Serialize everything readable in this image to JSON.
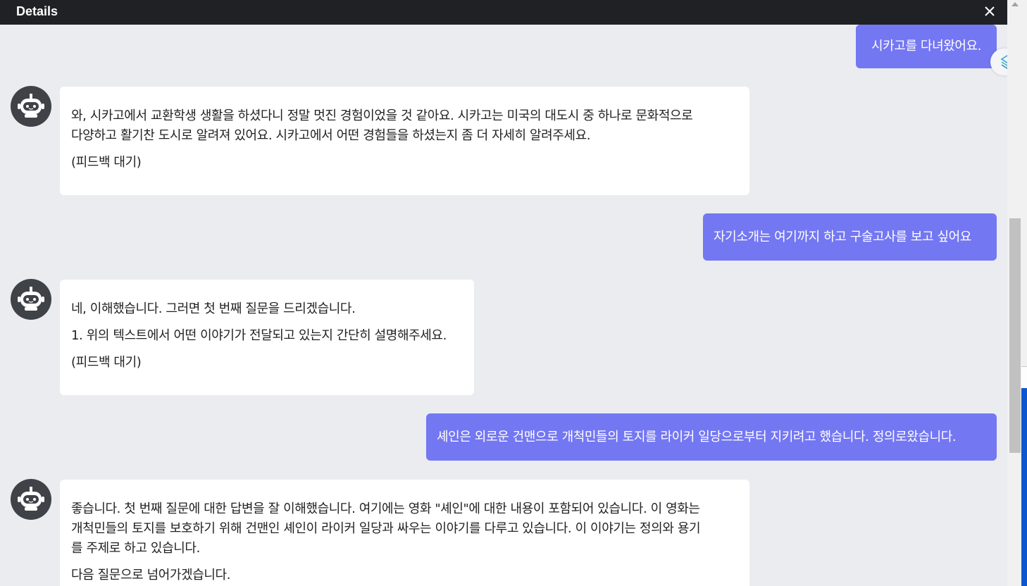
{
  "header": {
    "title": "Details",
    "close_icon": "close-icon"
  },
  "colors": {
    "header_bg": "#1f2125",
    "chat_bg": "#eaecef",
    "user_bubble": "#7477f2",
    "bot_bubble": "#ffffff"
  },
  "messages": [
    {
      "role": "user",
      "text": "시카고를 다녀왔어요."
    },
    {
      "role": "bot",
      "lines": [
        "와, 시카고에서 교환학생 생활을 하셨다니 정말 멋진 경험이었을 것 같아요. 시카고는 미국의 대도시 중 하나로 문화적으로",
        "다양하고 활기찬 도시로 알려져 있어요. 시카고에서 어떤 경험들을 하셨는지 좀 더 자세히 알려주세요.",
        "(피드백 대기)"
      ]
    },
    {
      "role": "user",
      "text": "자기소개는 여기까지 하고 구술고사를 보고 싶어요"
    },
    {
      "role": "bot",
      "lines": [
        "네, 이해했습니다. 그러면 첫 번째 질문을 드리겠습니다.",
        "1. 위의 텍스트에서 어떤 이야기가 전달되고 있는지 간단히 설명해주세요.",
        "(피드백 대기)"
      ]
    },
    {
      "role": "user",
      "text": "셰인은 외로운 건맨으로 개척민들의 토지를 라이커 일당으로부터 지키려고 했습니다. 정의로왔습니다."
    },
    {
      "role": "bot",
      "lines": [
        "좋습니다. 첫 번째 질문에 대한 답변을 잘 이해했습니다. 여기에는 영화 \"셰인\"에 대한 내용이 포함되어 있습니다. 이 영화는",
        "개척민들의 토지를 보호하기 위해 건맨인 셰인이 라이커 일당과 싸우는 이야기를 다루고 있습니다. 이 이야기는 정의와 용기",
        "를 주제로 하고 있습니다.",
        "다음 질문으로 넘어가겠습니다."
      ]
    }
  ],
  "icons": {
    "avatar": "robot-avatar-icon",
    "side_tab": "assistant-extension-icon"
  }
}
